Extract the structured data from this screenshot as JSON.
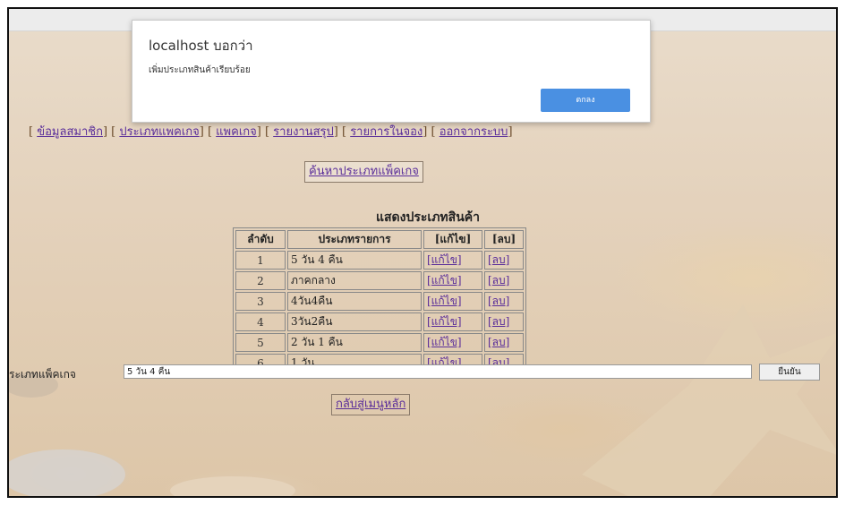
{
  "dialog": {
    "title": "localhost บอกว่า",
    "message": "เพิ่มประเภทสินค้าเรียบร้อย",
    "ok_label": "ตกลง"
  },
  "nav": {
    "items": [
      "ข้อมูลสมาชิก",
      "ประเภทแพคเกจ",
      "แพคเกจ",
      "รายงานสรุป",
      "รายการในจอง",
      "ออกจากระบบ"
    ]
  },
  "search_link": "ค้นหาประเภทแพ็คเกจ",
  "heading": "แสดงประเภทสินค้า",
  "table": {
    "headers": [
      "ลำดับ",
      "ประเภทรายการ",
      "[แก้ไข]",
      "[ลบ]"
    ],
    "rows": [
      {
        "no": "1",
        "name": "5 วัน 4 คืน",
        "edit": "[แก้ไข]",
        "del": "[ลบ]"
      },
      {
        "no": "2",
        "name": "ภาคกลาง",
        "edit": "[แก้ไข]",
        "del": "[ลบ]"
      },
      {
        "no": "3",
        "name": "4วัน4คืน",
        "edit": "[แก้ไข]",
        "del": "[ลบ]"
      },
      {
        "no": "4",
        "name": "3วัน2คืน",
        "edit": "[แก้ไข]",
        "del": "[ลบ]"
      },
      {
        "no": "5",
        "name": "2 วัน 1 คืน",
        "edit": "[แก้ไข]",
        "del": "[ลบ]"
      },
      {
        "no": "6",
        "name": "1 วัน",
        "edit": "[แก้ไข]",
        "del": "[ลบ]"
      }
    ]
  },
  "form": {
    "label": "ระเภทแพ็คเกจ",
    "value": "5 วัน 4 คืน",
    "submit_label": "ยืนยัน"
  },
  "back_link": "กลับสู่เมนูหลัก"
}
